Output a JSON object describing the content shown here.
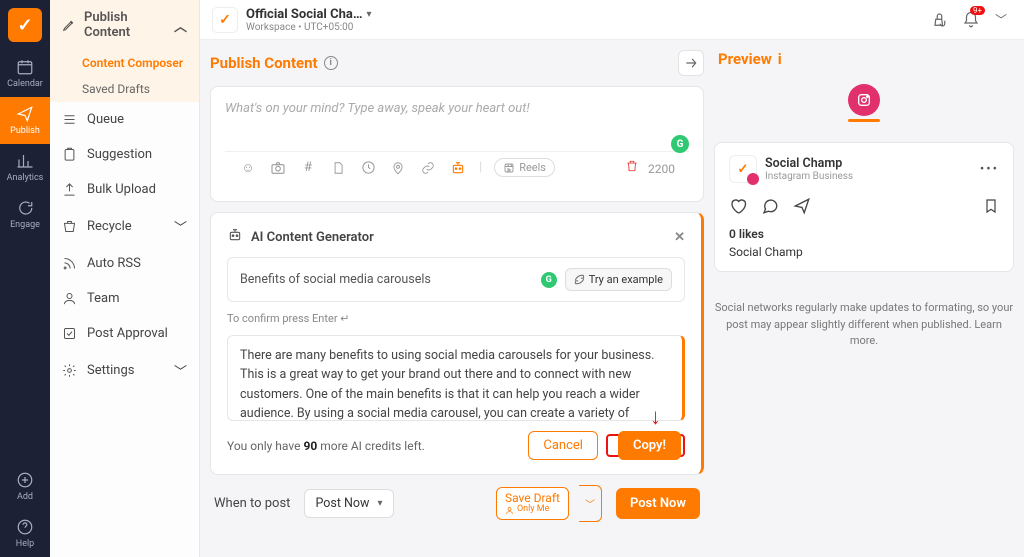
{
  "workspace": {
    "name": "Official Social Cha…",
    "meta": "Workspace • UTC+05:00"
  },
  "notif_count": "9+",
  "rail": {
    "calendar": "Calendar",
    "publish": "Publish",
    "analytics": "Analytics",
    "engage": "Engage",
    "add": "Add",
    "help": "Help"
  },
  "sidenav": {
    "head": "Publish Content",
    "composer": "Content Composer",
    "drafts": "Saved Drafts",
    "queue": "Queue",
    "suggestion": "Suggestion",
    "bulk": "Bulk Upload",
    "recycle": "Recycle",
    "autorss": "Auto RSS",
    "team": "Team",
    "approval": "Post Approval",
    "settings": "Settings"
  },
  "publish": {
    "title": "Publish Content",
    "placeholder": "What's on your mind? Type away, speak your heart out!",
    "char_count": "2200",
    "reels": "Reels"
  },
  "ai": {
    "title": "AI Content Generator",
    "input": "Benefits of social media carousels",
    "try_example": "Try an example",
    "hint": "To confirm press Enter ↵",
    "output": "There are many benefits to using social media carousels for your business. This is a great way to get your brand out there and to connect with new customers. One of the main benefits is that it can help you reach a wider audience. By using a social media carousel, you can create a variety of different posts that are all related to your brand. This will help you build a following and make sure that your message is",
    "credits_pre": "You only have ",
    "credits_num": "90",
    "credits_post": " more AI credits left.",
    "cancel": "Cancel",
    "copy": "Copy!"
  },
  "schedule": {
    "when": "When to post",
    "option": "Post Now",
    "save_draft": "Save Draft",
    "only_me": "Only Me",
    "post_now": "Post Now"
  },
  "preview": {
    "title": "Preview",
    "account": "Social Champ",
    "account_sub": "Instagram Business",
    "likes": "0 likes",
    "caption": "Social Champ",
    "disclaimer": "Social networks regularly make updates to formating, so your post may appear slightly different when published. Learn more."
  }
}
